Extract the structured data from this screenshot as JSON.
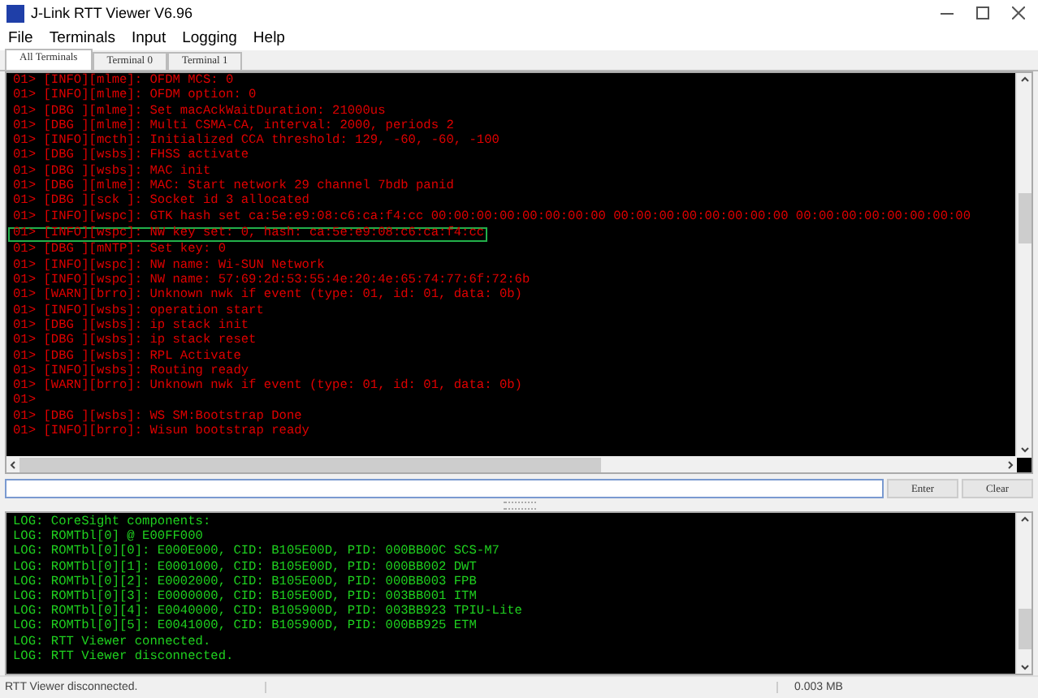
{
  "window": {
    "title": "J-Link RTT Viewer V6.96"
  },
  "menu": [
    "File",
    "Terminals",
    "Input",
    "Logging",
    "Help"
  ],
  "tabs": [
    {
      "label": "All Terminals",
      "selected": true
    },
    {
      "label": "Terminal 0",
      "selected": false
    },
    {
      "label": "Terminal 1",
      "selected": false
    }
  ],
  "log_lines": [
    {
      "text": "01> [INFO][mlme]: OFDM MCS: 0",
      "highlighted": false
    },
    {
      "text": "01> [INFO][mlme]: OFDM option: 0",
      "highlighted": false
    },
    {
      "text": "01> [DBG ][mlme]: Set macAckWaitDuration: 21000us",
      "highlighted": false
    },
    {
      "text": "01> [DBG ][mlme]: Multi CSMA-CA, interval: 2000, periods 2",
      "highlighted": false
    },
    {
      "text": "01> [INFO][mcth]: Initialized CCA threshold: 129, -60, -60, -100",
      "highlighted": false
    },
    {
      "text": "01> [DBG ][wsbs]: FHSS activate",
      "highlighted": false
    },
    {
      "text": "01> [DBG ][wsbs]: MAC init",
      "highlighted": false
    },
    {
      "text": "01> [DBG ][mlme]: MAC: Start network 29 channel 7bdb panid",
      "highlighted": false
    },
    {
      "text": "01> [DBG ][sck ]: Socket id 3 allocated",
      "highlighted": false
    },
    {
      "text": "01> [INFO][wspc]: GTK hash set ca:5e:e9:08:c6:ca:f4:cc 00:00:00:00:00:00:00:00 00:00:00:00:00:00:00:00 00:00:00:00:00:00:00:00",
      "highlighted": false
    },
    {
      "text": "01> [INFO][wspc]: NW key set: 0, hash: ca:5e:e9:08:c6:ca:f4:cc",
      "highlighted": true
    },
    {
      "text": "01> [DBG ][mNTP]: Set key: 0",
      "highlighted": false
    },
    {
      "text": "01> [INFO][wspc]: NW name: Wi-SUN Network",
      "highlighted": false
    },
    {
      "text": "01> [INFO][wspc]: NW name: 57:69:2d:53:55:4e:20:4e:65:74:77:6f:72:6b",
      "highlighted": false
    },
    {
      "text": "01> [WARN][brro]: Unknown nwk if event (type: 01, id: 01, data: 0b)",
      "highlighted": false
    },
    {
      "text": "01> [INFO][wsbs]: operation start",
      "highlighted": false
    },
    {
      "text": "01> [DBG ][wsbs]: ip stack init",
      "highlighted": false
    },
    {
      "text": "01> [DBG ][wsbs]: ip stack reset",
      "highlighted": false
    },
    {
      "text": "01> [DBG ][wsbs]: RPL Activate",
      "highlighted": false
    },
    {
      "text": "01> [INFO][wsbs]: Routing ready",
      "highlighted": false
    },
    {
      "text": "01> [WARN][brro]: Unknown nwk if event (type: 01, id: 01, data: 0b)",
      "highlighted": false
    },
    {
      "text": "01>",
      "highlighted": false
    },
    {
      "text": "01> [DBG ][wsbs]: WS SM:Bootstrap Done",
      "highlighted": false
    },
    {
      "text": "01> [INFO][brro]: Wisun bootstrap ready",
      "highlighted": false
    }
  ],
  "input": {
    "buttons": [
      "Enter",
      "Clear"
    ]
  },
  "system_log": [
    "LOG: CoreSight components:",
    "LOG: ROMTbl[0] @ E00FF000",
    "LOG: ROMTbl[0][0]: E000E000, CID: B105E00D, PID: 000BB00C SCS-M7",
    "LOG: ROMTbl[0][1]: E0001000, CID: B105E00D, PID: 000BB002 DWT",
    "LOG: ROMTbl[0][2]: E0002000, CID: B105E00D, PID: 000BB003 FPB",
    "LOG: ROMTbl[0][3]: E0000000, CID: B105E00D, PID: 003BB001 ITM",
    "LOG: ROMTbl[0][4]: E0040000, CID: B105900D, PID: 003BB923 TPIU-Lite",
    "LOG: ROMTbl[0][5]: E0041000, CID: B105900D, PID: 000BB925 ETM",
    "LOG: RTT Viewer connected.",
    "LOG: RTT Viewer disconnected."
  ],
  "status_bar": [
    "RTT Viewer disconnected.",
    "0.003 MB"
  ]
}
